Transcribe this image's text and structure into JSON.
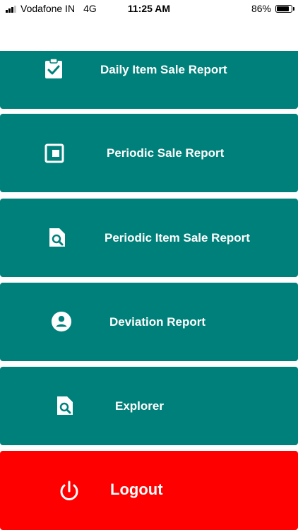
{
  "status_bar": {
    "carrier": "Vodafone IN",
    "network": "4G",
    "time": "11:25 AM",
    "battery_percent_label": "86%",
    "battery_level": 0.86
  },
  "menu": {
    "items": [
      {
        "label": "Daily Item Sale Report",
        "icon": "clipboard-check-icon"
      },
      {
        "label": "Periodic Sale Report",
        "icon": "square-frame-icon"
      },
      {
        "label": "Periodic Item Sale Report",
        "icon": "document-search-icon"
      },
      {
        "label": "Deviation Report",
        "icon": "account-circle-icon"
      },
      {
        "label": "Explorer",
        "icon": "document-search-icon"
      }
    ],
    "logout": {
      "label": "Logout",
      "icon": "power-icon"
    }
  },
  "colors": {
    "primary": "#00807a",
    "logout": "#ff0000",
    "text": "#ffffff"
  }
}
